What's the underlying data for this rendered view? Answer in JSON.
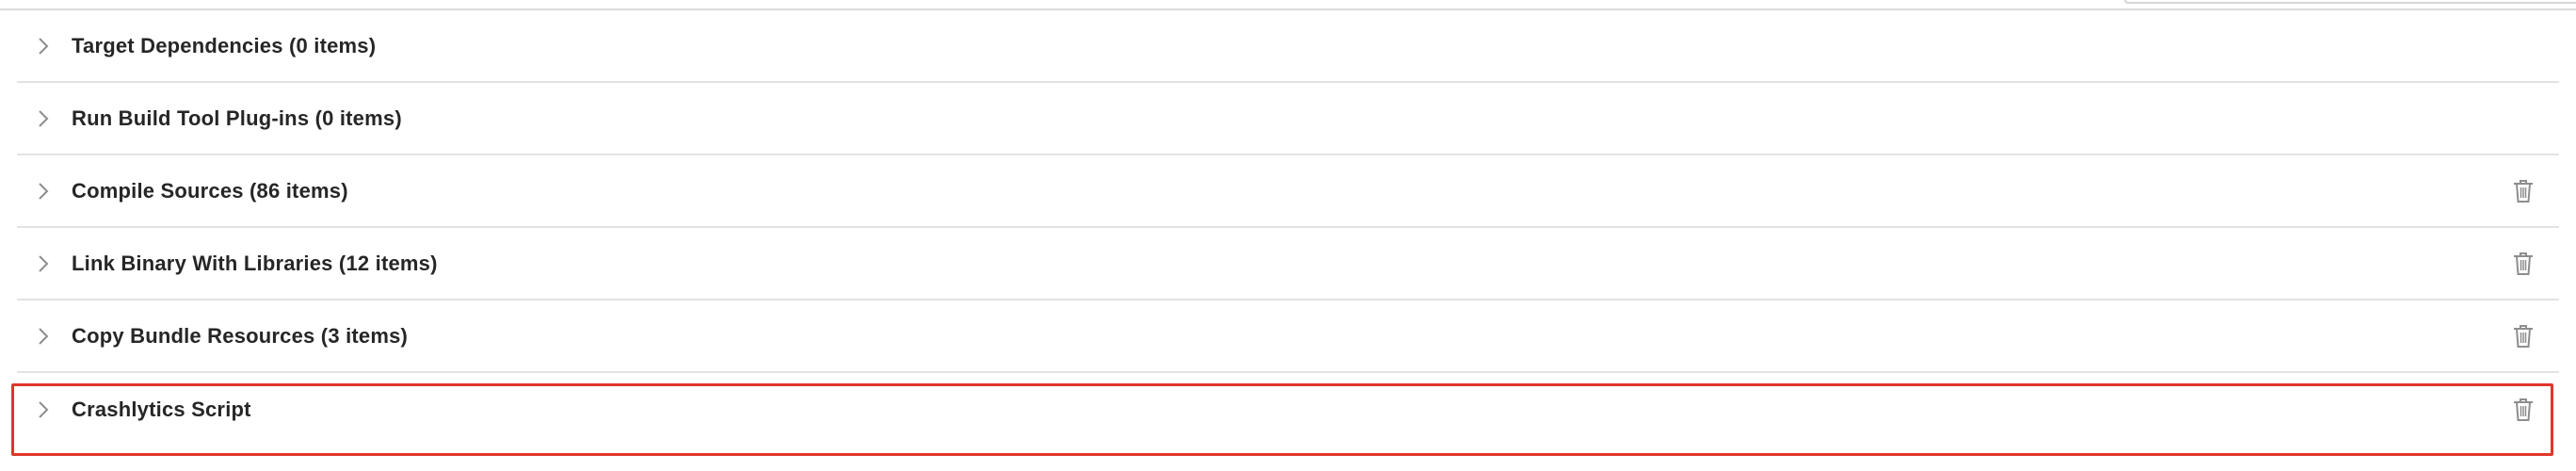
{
  "build_phases": {
    "items": [
      {
        "label": "Target Dependencies (0 items)",
        "deletable": false
      },
      {
        "label": "Run Build Tool Plug-ins (0 items)",
        "deletable": false
      },
      {
        "label": "Compile Sources (86 items)",
        "deletable": true
      },
      {
        "label": "Link Binary With Libraries (12 items)",
        "deletable": true
      },
      {
        "label": "Copy Bundle Resources (3 items)",
        "deletable": true
      },
      {
        "label": "Crashlytics Script",
        "deletable": true
      }
    ]
  },
  "colors": {
    "highlight": "#e0362b",
    "text": "#262626",
    "icon": "#8e8e8e",
    "divider": "#e2e2e2"
  },
  "icons": {
    "disclosure": "chevron-right-icon",
    "delete": "trash-icon"
  }
}
